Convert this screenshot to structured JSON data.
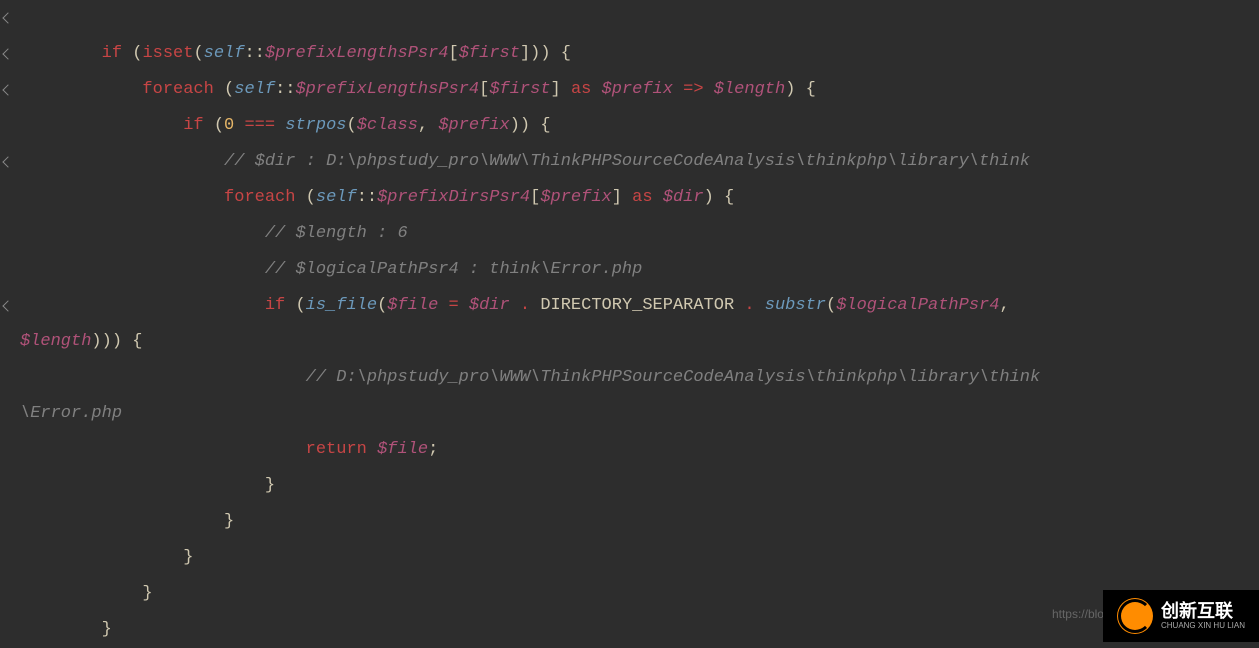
{
  "code": {
    "line1_if": "if",
    "line1_isset": "isset",
    "line1_self": "self",
    "line1_var1": "$prefixLengthsPsr4",
    "line1_var2": "$first",
    "line2_foreach": "foreach",
    "line2_self": "self",
    "line2_var1": "$prefixLengthsPsr4",
    "line2_var2": "$first",
    "line2_as": "as",
    "line2_prefix": "$prefix",
    "line2_arrow": "=>",
    "line2_length": "$length",
    "line3_if": "if",
    "line3_zero": "0",
    "line3_eq": "===",
    "line3_strpos": "strpos",
    "line3_class": "$class",
    "line3_prefix": "$prefix",
    "line4_comment": "// $dir : D:\\phpstudy_pro\\WWW\\ThinkPHPSourceCodeAnalysis\\thinkphp\\library\\think",
    "line5_foreach": "foreach",
    "line5_self": "self",
    "line5_var": "$prefixDirsPsr4",
    "line5_prefix": "$prefix",
    "line5_as": "as",
    "line5_dir": "$dir",
    "line6_comment": "// $length : 6",
    "line7_comment": "// $logicalPathPsr4 : think\\Error.php",
    "line8_if": "if",
    "line8_isfile": "is_file",
    "line8_file": "$file",
    "line8_dir": "$dir",
    "line8_const": "DIRECTORY_SEPARATOR",
    "line8_substr": "substr",
    "line8_logical": "$logicalPathPsr4",
    "line9_length": "$length",
    "line10_comment": "// D:\\phpstudy_pro\\WWW\\ThinkPHPSourceCodeAnalysis\\thinkphp\\library\\think",
    "line11_comment": "\\Error.php",
    "line12_return": "return",
    "line12_file": "$file"
  },
  "watermark": {
    "main": "创新互联",
    "sub": "CHUANG XIN HU LIAN",
    "url": "https://blog."
  }
}
